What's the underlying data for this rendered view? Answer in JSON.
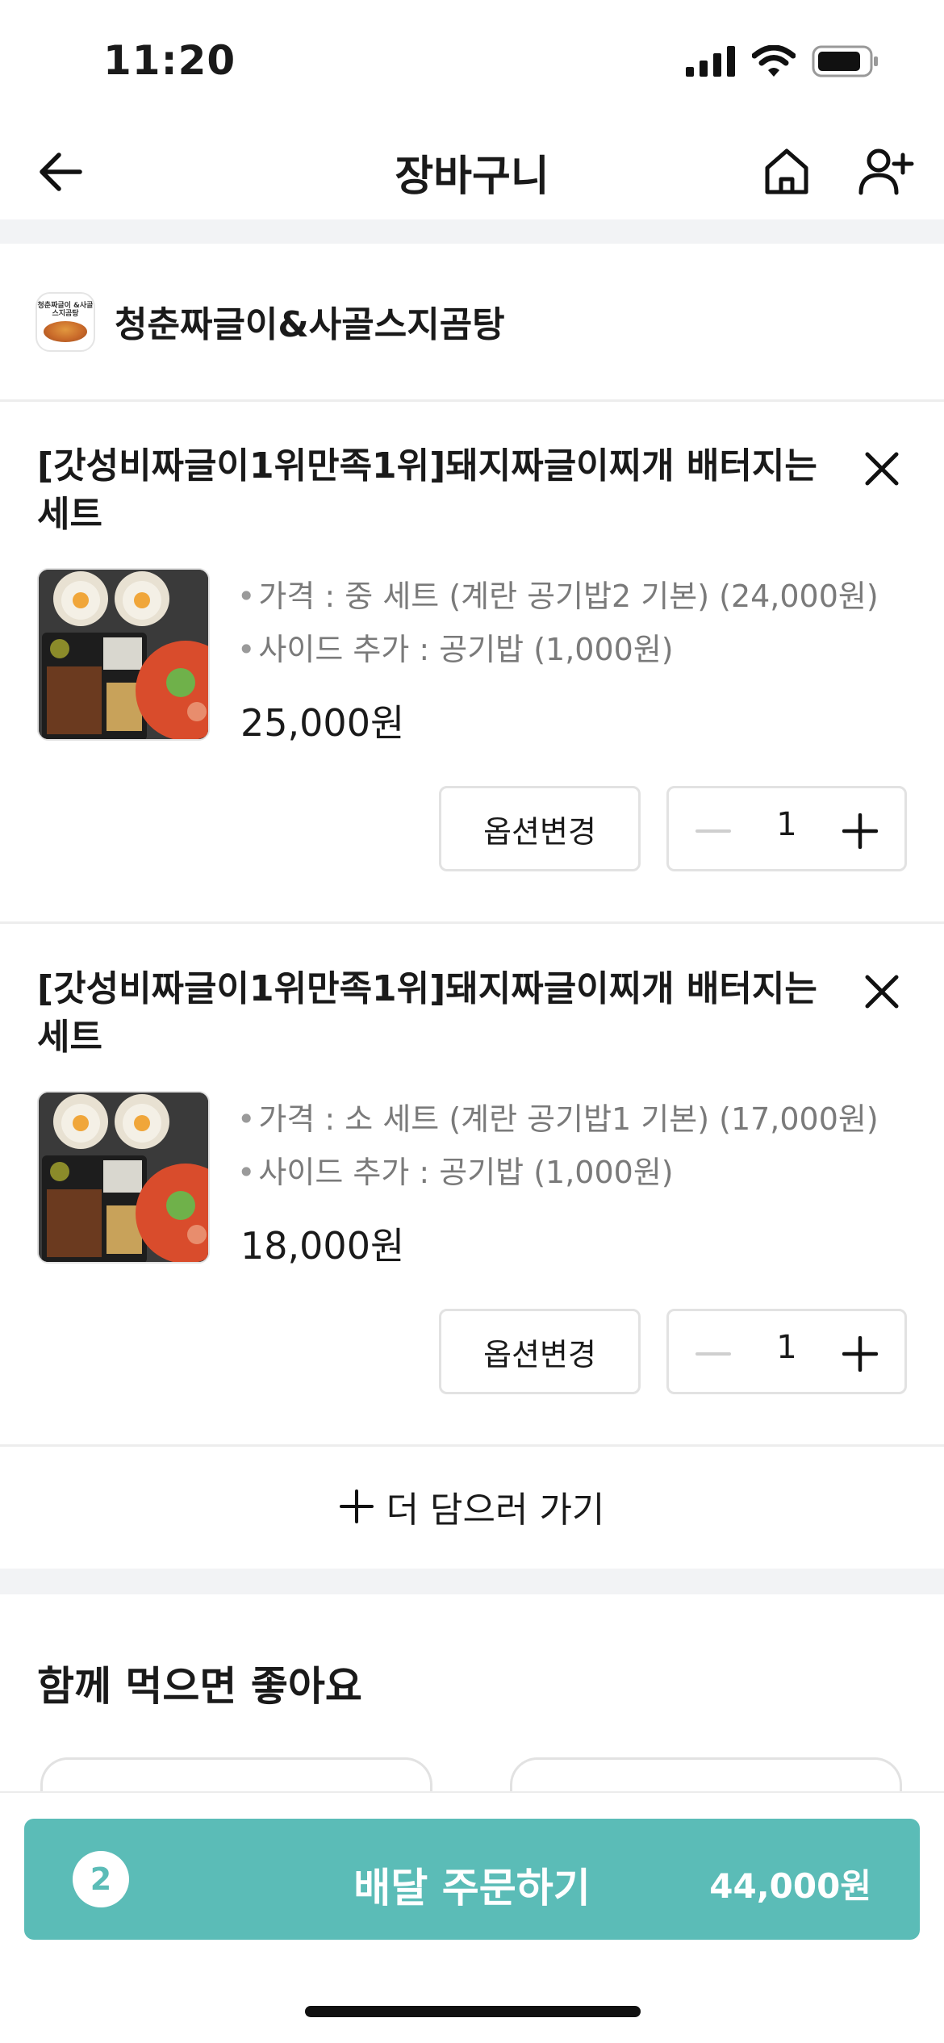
{
  "status_bar": {
    "time": "11:20"
  },
  "header": {
    "title": "장바구니"
  },
  "store": {
    "name": "청춘짜글이&사골스지곰탕",
    "logo_text": "청춘짜글이 &사골스지곰탕"
  },
  "cart_items": [
    {
      "title": "[갓성비짜글이1위만족1위]돼지짜글이찌개 배터지는 세트",
      "option_price": "가격 : 중 세트 (계란 공기밥2 기본) (24,000원)",
      "option_side": "사이드 추가 : 공기밥 (1,000원)",
      "price": "25,000원",
      "option_change_label": "옵션변경",
      "quantity": "1"
    },
    {
      "title": "[갓성비짜글이1위만족1위]돼지짜글이찌개 배터지는 세트",
      "option_price": "가격 : 소 세트 (계란 공기밥1 기본) (17,000원)",
      "option_side": "사이드 추가 : 공기밥 (1,000원)",
      "price": "18,000원",
      "option_change_label": "옵션변경",
      "quantity": "1"
    }
  ],
  "add_more": {
    "label": "더 담으러 가기"
  },
  "recommend": {
    "title": "함께 먹으면 좋아요"
  },
  "order": {
    "count": "2",
    "label": "배달 주문하기",
    "total": "44,000원"
  },
  "colors": {
    "accent": "#5bbcb7",
    "band": "#f2f3f5",
    "border": "#e2e2e2",
    "muted_text": "#7a7a7a"
  },
  "icons": {
    "back": "arrow-left-icon",
    "home": "home-icon",
    "add_user": "person-plus-icon",
    "remove": "close-icon",
    "minus": "minus-icon",
    "plus": "plus-icon"
  }
}
